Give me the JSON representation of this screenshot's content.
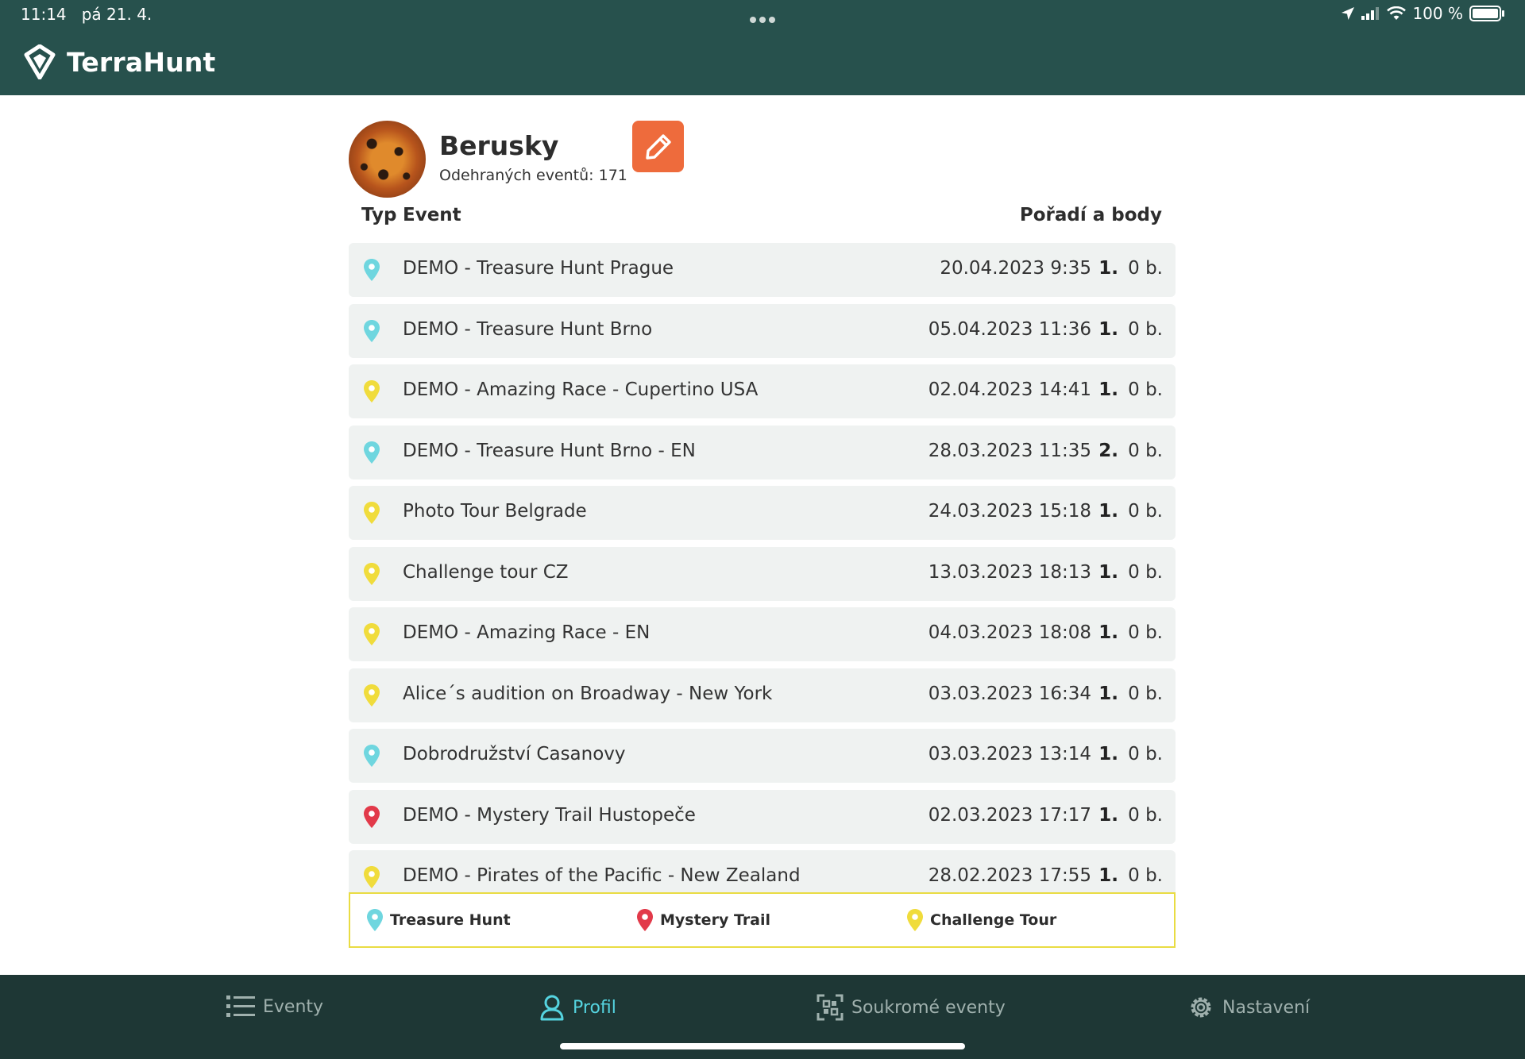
{
  "status_bar": {
    "time": "11:14",
    "date": "pá 21. 4.",
    "battery": "100 %"
  },
  "app": {
    "title": "TerraHunt"
  },
  "profile": {
    "name": "Berusky",
    "events_played_label": "Odehraných eventů: 171"
  },
  "table": {
    "col_type": "Typ",
    "col_event": "Event",
    "col_rank_points": "Pořadí a body"
  },
  "colors": {
    "treasure_hunt": "#6fd6df",
    "mystery_trail": "#e23a4a",
    "challenge_tour": "#f0dc3c",
    "header": "#27514d",
    "edit_button": "#ee6b3c",
    "nav_active": "#55d4e0"
  },
  "events": [
    {
      "type": "treasure_hunt",
      "name": "DEMO - Treasure Hunt Prague",
      "date": "20.04.2023 9:35",
      "rank": "1.",
      "points": "0 b."
    },
    {
      "type": "treasure_hunt",
      "name": "DEMO - Treasure Hunt Brno",
      "date": "05.04.2023 11:36",
      "rank": "1.",
      "points": "0 b."
    },
    {
      "type": "challenge_tour",
      "name": "DEMO - Amazing Race - Cupertino USA",
      "date": "02.04.2023 14:41",
      "rank": "1.",
      "points": "0 b."
    },
    {
      "type": "treasure_hunt",
      "name": "DEMO - Treasure Hunt Brno - EN",
      "date": "28.03.2023 11:35",
      "rank": "2.",
      "points": "0 b."
    },
    {
      "type": "challenge_tour",
      "name": "Photo Tour Belgrade",
      "date": "24.03.2023 15:18",
      "rank": "1.",
      "points": "0 b."
    },
    {
      "type": "challenge_tour",
      "name": "Challenge tour CZ",
      "date": "13.03.2023 18:13",
      "rank": "1.",
      "points": "0 b."
    },
    {
      "type": "challenge_tour",
      "name": "DEMO - Amazing Race - EN",
      "date": "04.03.2023 18:08",
      "rank": "1.",
      "points": "0 b."
    },
    {
      "type": "challenge_tour",
      "name": "Alice´s audition on Broadway - New York",
      "date": "03.03.2023 16:34",
      "rank": "1.",
      "points": "0 b."
    },
    {
      "type": "treasure_hunt",
      "name": "Dobrodružství Casanovy",
      "date": "03.03.2023 13:14",
      "rank": "1.",
      "points": "0 b."
    },
    {
      "type": "mystery_trail",
      "name": "DEMO - Mystery Trail Hustopeče",
      "date": "02.03.2023 17:17",
      "rank": "1.",
      "points": "0 b."
    },
    {
      "type": "challenge_tour",
      "name": "DEMO - Pirates of the Pacific - New Zealand",
      "date": "28.02.2023 17:55",
      "rank": "1.",
      "points": "0 b."
    }
  ],
  "legend": {
    "treasure_hunt": "Treasure Hunt",
    "mystery_trail": "Mystery Trail",
    "challenge_tour": "Challenge Tour"
  },
  "nav": {
    "events": "Eventy",
    "profile": "Profil",
    "private_events": "Soukromé eventy",
    "settings": "Nastavení",
    "active": "profile"
  }
}
